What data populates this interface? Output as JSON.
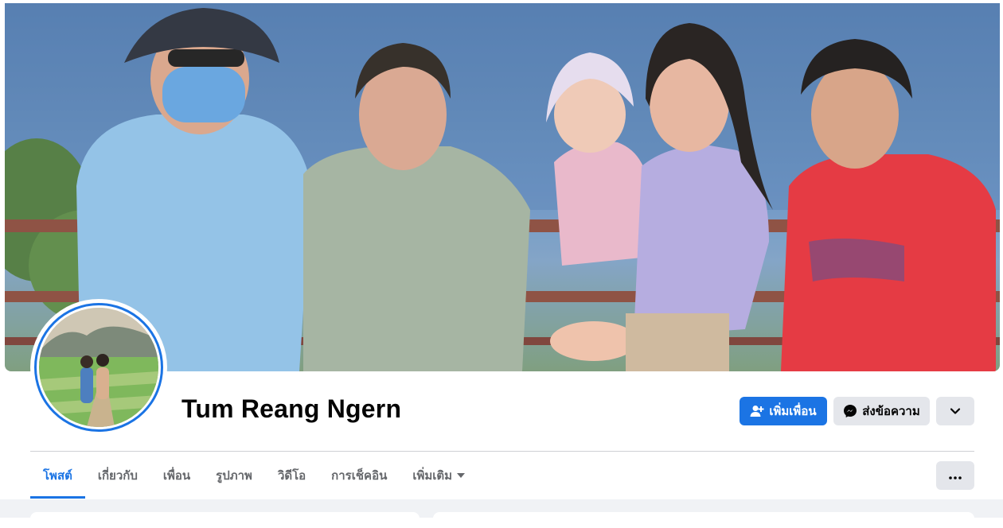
{
  "profile": {
    "name": "Tum Reang Ngern"
  },
  "actions": {
    "add_friend_label": "เพิ่มเพื่อน",
    "message_label": "ส่งข้อความ"
  },
  "tabs": [
    {
      "label": "โพสต์"
    },
    {
      "label": "เกี่ยวกับ"
    },
    {
      "label": "เพื่อน"
    },
    {
      "label": "รูปภาพ"
    },
    {
      "label": "วิดีโอ"
    },
    {
      "label": "การเช็คอิน"
    },
    {
      "label": "เพิ่มเติม"
    }
  ],
  "icons": {
    "add_friend": "add-friend-icon",
    "messenger": "messenger-icon",
    "dropdown": "chevron-down-icon",
    "more": "more-dots-icon"
  },
  "colors": {
    "accent": "#1b74e4",
    "secondary_button": "#e4e6eb",
    "page_background": "#f0f2f5",
    "muted_text": "#65676b"
  }
}
